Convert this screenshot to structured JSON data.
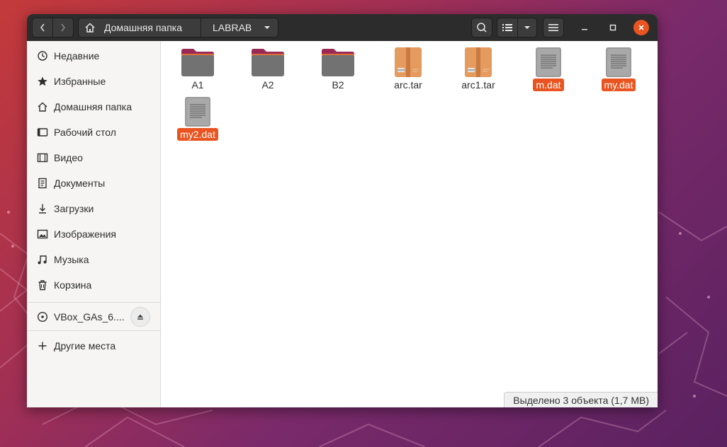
{
  "window": {
    "breadcrumb": {
      "home_label": "Домашняя папка",
      "current_folder": "LABRAB"
    },
    "accent_color": "#e95420"
  },
  "sidebar": {
    "items": [
      {
        "label": "Недавние",
        "icon": "clock-icon"
      },
      {
        "label": "Избранные",
        "icon": "star-icon"
      },
      {
        "label": "Домашняя папка",
        "icon": "home-icon"
      },
      {
        "label": "Рабочий стол",
        "icon": "desktop-icon"
      },
      {
        "label": "Видео",
        "icon": "video-icon"
      },
      {
        "label": "Документы",
        "icon": "document-icon"
      },
      {
        "label": "Загрузки",
        "icon": "download-icon"
      },
      {
        "label": "Изображения",
        "icon": "image-icon"
      },
      {
        "label": "Музыка",
        "icon": "music-icon"
      },
      {
        "label": "Корзина",
        "icon": "trash-icon"
      }
    ],
    "device": {
      "label": "VBox_GAs_6....",
      "icon": "disc-icon"
    },
    "other_places": {
      "label": "Другие места",
      "icon": "plus-icon"
    }
  },
  "files": [
    {
      "name": "A1",
      "type": "folder",
      "selected": false
    },
    {
      "name": "A2",
      "type": "folder",
      "selected": false
    },
    {
      "name": "B2",
      "type": "folder",
      "selected": false
    },
    {
      "name": "arc.tar",
      "type": "archive",
      "selected": false
    },
    {
      "name": "arc1.tar",
      "type": "archive",
      "selected": false
    },
    {
      "name": "m.dat",
      "type": "data",
      "selected": true
    },
    {
      "name": "my.dat",
      "type": "data",
      "selected": true
    },
    {
      "name": "my2.dat",
      "type": "data",
      "selected": true
    }
  ],
  "status": {
    "text": "Выделено 3 объекта  (1,7 MB)"
  }
}
